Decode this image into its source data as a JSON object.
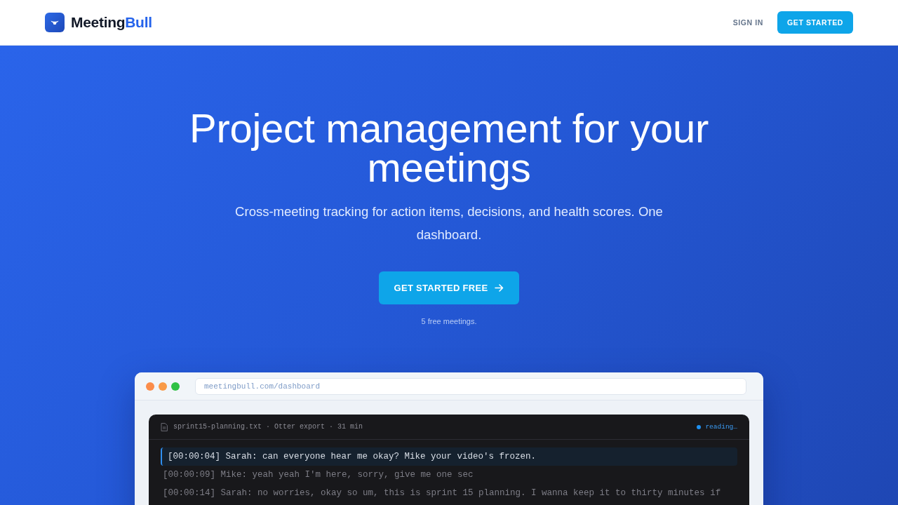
{
  "nav": {
    "brand": {
      "main": "Meeting",
      "accent": "Bull"
    },
    "actions": [
      {
        "label": "SIGN IN",
        "kind": "link"
      },
      {
        "label": "GET STARTED",
        "kind": "button"
      }
    ]
  },
  "hero": {
    "title": "Project management for your meetings",
    "subtitle": "Cross-meeting tracking for action items, decisions, and health scores. One dashboard.",
    "cta": "GET STARTED FREE",
    "note": "5 free meetings."
  },
  "preview": {
    "url": "meetingbull.com/dashboard",
    "transcript": {
      "file_info": "sprint15-planning.txt · Otter export · 31 min",
      "status": "reading…",
      "lines": [
        {
          "text": "[00:00:04] Sarah: can everyone hear me okay? Mike your video's frozen.",
          "highlighted": true
        },
        {
          "text": "[00:00:09] Mike: yeah yeah I'm here, sorry, give me one sec",
          "highlighted": false
        },
        {
          "text": "[00:00:14] Sarah: no worries, okay so um, this is sprint 15 planning. I wanna keep it to thirty minutes if",
          "highlighted": false
        }
      ]
    }
  }
}
